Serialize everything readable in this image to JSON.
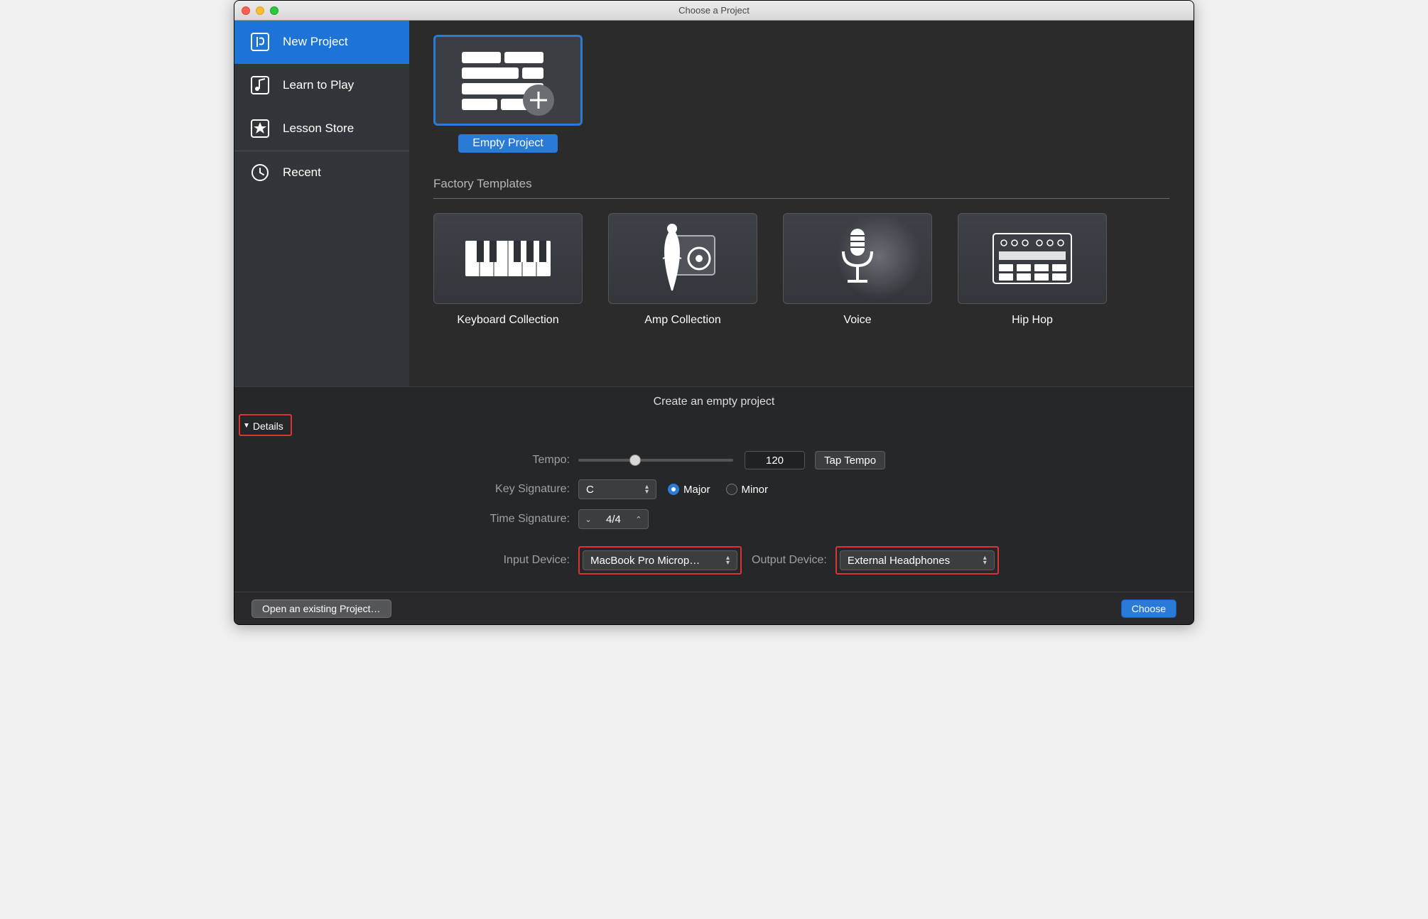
{
  "window": {
    "title": "Choose a Project"
  },
  "sidebar": {
    "items": [
      {
        "label": "New Project",
        "icon": "new-project-icon",
        "selected": true
      },
      {
        "label": "Learn to Play",
        "icon": "learn-icon",
        "selected": false
      },
      {
        "label": "Lesson Store",
        "icon": "store-icon",
        "selected": false
      },
      {
        "label": "Recent",
        "icon": "recent-icon",
        "selected": false
      }
    ]
  },
  "main": {
    "empty_project": {
      "label": "Empty Project"
    },
    "factory_templates_title": "Factory Templates",
    "templates": [
      {
        "label": "Keyboard Collection",
        "icon": "keyboard-icon"
      },
      {
        "label": "Amp Collection",
        "icon": "amp-icon"
      },
      {
        "label": "Voice",
        "icon": "voice-icon"
      },
      {
        "label": "Hip Hop",
        "icon": "hiphop-icon"
      }
    ],
    "subtitle": "Create an empty project"
  },
  "details": {
    "toggle_label": "Details",
    "tempo_label": "Tempo:",
    "tempo_value": "120",
    "tap_tempo_label": "Tap Tempo",
    "key_signature_label": "Key Signature:",
    "key_value": "C",
    "major_label": "Major",
    "minor_label": "Minor",
    "time_signature_label": "Time Signature:",
    "time_value": "4/4",
    "input_device_label": "Input Device:",
    "input_device_value": "MacBook Pro Microp…",
    "output_device_label": "Output Device:",
    "output_device_value": "External Headphones"
  },
  "footer": {
    "open_label": "Open an existing Project…",
    "choose_label": "Choose"
  },
  "colors": {
    "accent": "#2a7ad8",
    "highlight": "#d33"
  }
}
